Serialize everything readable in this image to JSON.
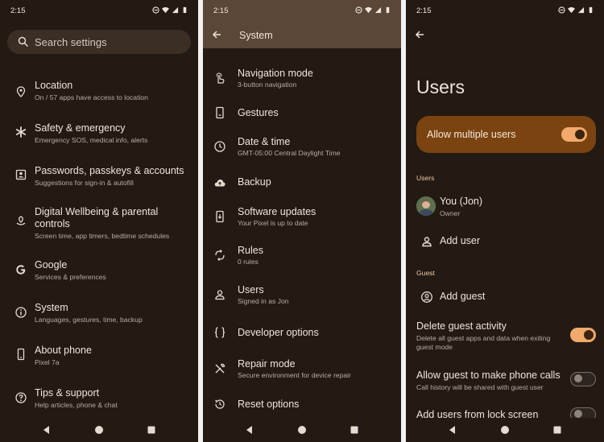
{
  "status": {
    "time": "2:15"
  },
  "panel1": {
    "search_placeholder": "Search settings",
    "items": [
      {
        "title": "Location",
        "subtitle": "On / 57 apps have access to location",
        "icon": "location-pin-icon"
      },
      {
        "title": "Safety & emergency",
        "subtitle": "Emergency SOS, medical info, alerts",
        "icon": "asterisk-icon"
      },
      {
        "title": "Passwords, passkeys & accounts",
        "subtitle": "Suggestions for sign-in & autofill",
        "icon": "account-box-icon"
      },
      {
        "title": "Digital Wellbeing & parental controls",
        "subtitle": "Screen time, app timers, bedtime schedules",
        "icon": "wellbeing-icon"
      },
      {
        "title": "Google",
        "subtitle": "Services & preferences",
        "icon": "google-g-icon"
      },
      {
        "title": "System",
        "subtitle": "Languages, gestures, time, backup",
        "icon": "info-icon"
      },
      {
        "title": "About phone",
        "subtitle": "Pixel 7a",
        "icon": "phone-icon"
      },
      {
        "title": "Tips & support",
        "subtitle": "Help articles, phone & chat",
        "icon": "help-icon"
      }
    ]
  },
  "panel2": {
    "title": "System",
    "items": [
      {
        "title": "Navigation mode",
        "subtitle": "3-button navigation",
        "icon": "gesture-hand-icon"
      },
      {
        "title": "Gestures",
        "subtitle": "",
        "icon": "phone-gesture-icon"
      },
      {
        "title": "Date & time",
        "subtitle": "GMT-05:00 Central Daylight Time",
        "icon": "clock-icon"
      },
      {
        "title": "Backup",
        "subtitle": "",
        "icon": "cloud-upload-icon"
      },
      {
        "title": "Software updates",
        "subtitle": "Your Pixel is up to date",
        "icon": "system-update-icon"
      },
      {
        "title": "Rules",
        "subtitle": "0 rules",
        "icon": "rules-icon"
      },
      {
        "title": "Users",
        "subtitle": "Signed in as Jon",
        "icon": "person-icon"
      },
      {
        "title": "Developer options",
        "subtitle": "",
        "icon": "braces-icon"
      },
      {
        "title": "Repair mode",
        "subtitle": "Secure environment for device repair",
        "icon": "tools-icon"
      },
      {
        "title": "Reset options",
        "subtitle": "",
        "icon": "restore-icon"
      }
    ]
  },
  "panel3": {
    "title": "Users",
    "allow_multiple": {
      "label": "Allow multiple users",
      "on": true
    },
    "users_header": "Users",
    "user_name": "You (Jon)",
    "user_role": "Owner",
    "add_user": "Add user",
    "guest_header": "Guest",
    "add_guest": "Add guest",
    "delete_guest": {
      "title": "Delete guest activity",
      "desc": "Delete all guest apps and data when exiting guest mode",
      "on": true
    },
    "guest_calls": {
      "title": "Allow guest to make phone calls",
      "desc": "Call history will be shared with guest user",
      "on": false
    },
    "lock_screen": {
      "title": "Add users from lock screen",
      "on": false
    }
  },
  "colors": {
    "background": "#231a14",
    "accent": "#f2a96b",
    "banner": "#7a4310"
  }
}
